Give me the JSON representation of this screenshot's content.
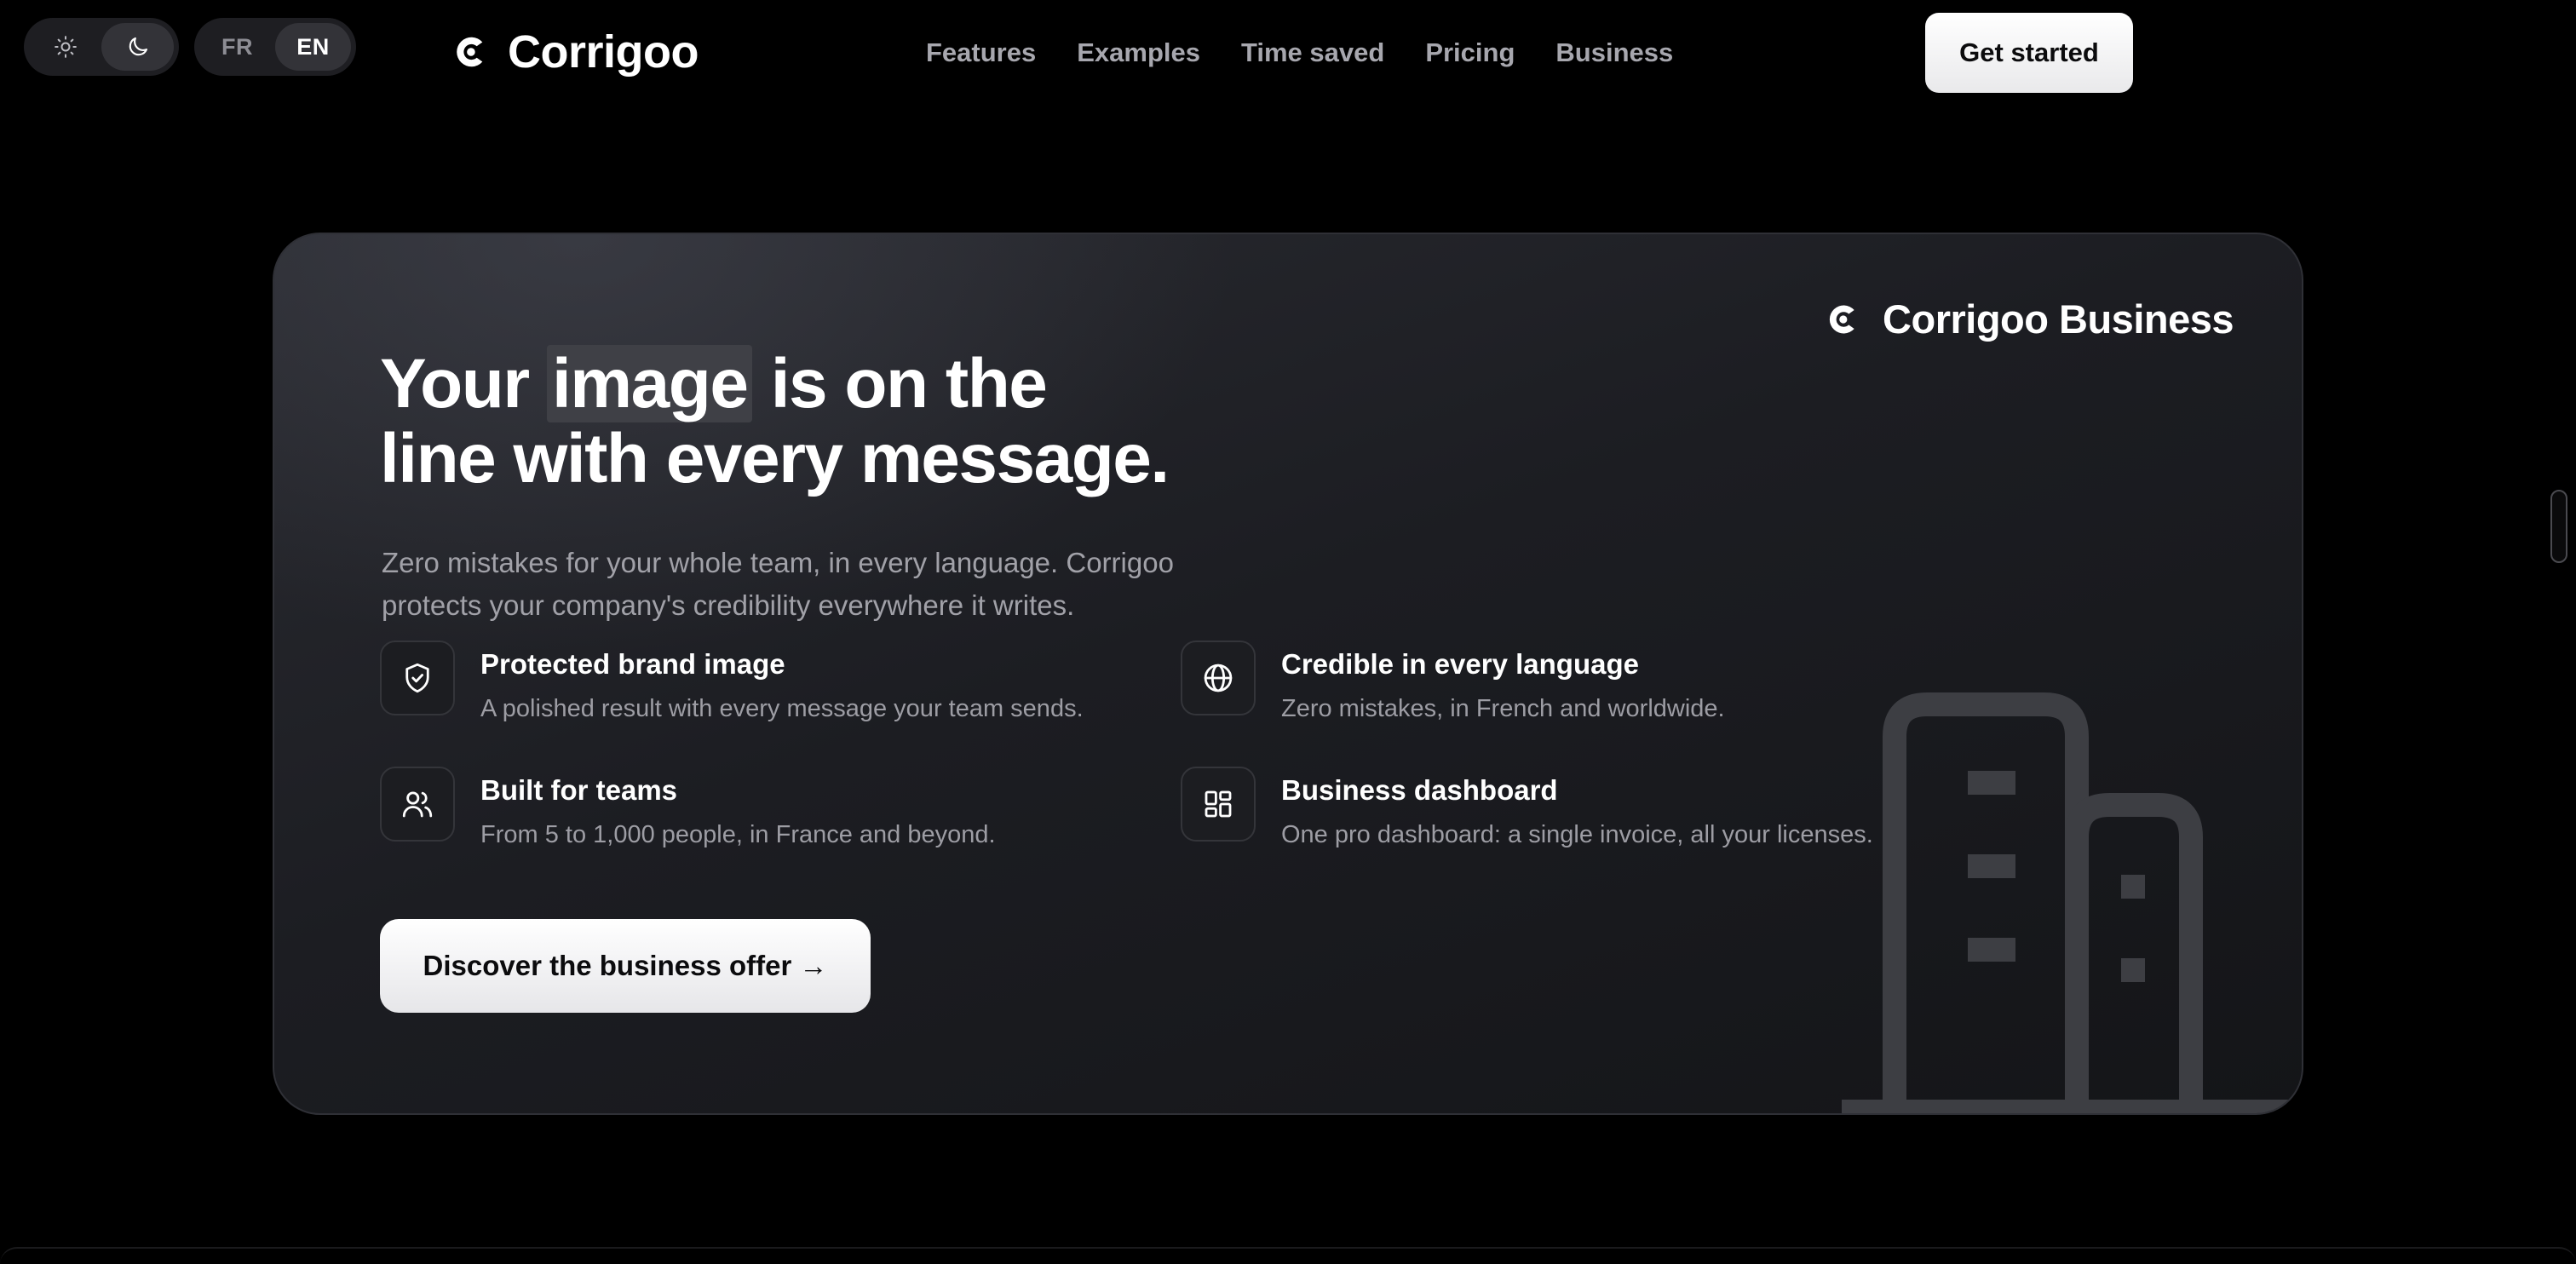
{
  "header": {
    "theme_toggle": {
      "options": [
        {
          "icon": "sun-icon",
          "label": "Light theme",
          "active": false
        },
        {
          "icon": "moon-icon",
          "label": "Dark theme",
          "active": true
        }
      ]
    },
    "language_toggle": {
      "options": [
        {
          "label": "FR",
          "active": false
        },
        {
          "label": "EN",
          "active": true
        }
      ]
    },
    "brand": {
      "name": "Corrigoo",
      "icon": "corrigoo-logo-icon"
    },
    "nav": [
      "Features",
      "Examples",
      "Time saved",
      "Pricing",
      "Business"
    ],
    "cta_label": "Get started"
  },
  "card": {
    "brand_name": "Corrigoo Business",
    "headline": {
      "before": "Your ",
      "highlight": "image",
      "after_line1": " is on the",
      "line2": "line with every message."
    },
    "subtitle": "Zero mistakes for your whole team, in every language. Corrigoo protects your company's credibility everywhere it writes.",
    "features": [
      {
        "icon": "shield-check-icon",
        "title": "Protected brand image",
        "description": "A polished result with every message your team sends."
      },
      {
        "icon": "globe-icon",
        "title": "Credible in every language",
        "description": "Zero mistakes, in French and worldwide."
      },
      {
        "icon": "users-icon",
        "title": "Built for teams",
        "description": "From 5 to 1,000 people, in France and beyond."
      },
      {
        "icon": "dashboard-grid-icon",
        "title": "Business dashboard",
        "description": "One pro dashboard: a single invoice, all your licenses."
      }
    ],
    "cta_label": "Discover the business offer →",
    "illustration": "buildings-icon"
  },
  "colors": {
    "background": "#000000",
    "card_background": "#1c1d22",
    "text_primary": "#ffffff",
    "text_secondary": "#a1a1a8",
    "button_background": "#ffffff",
    "button_text": "#0b0b0d"
  }
}
